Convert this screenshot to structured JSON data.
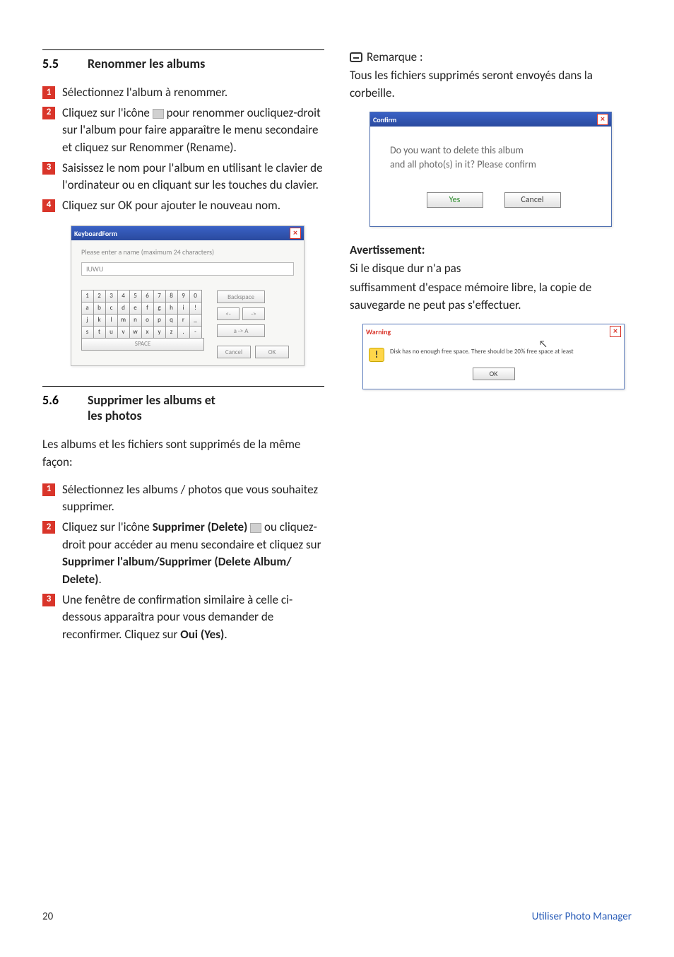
{
  "left": {
    "sec55": {
      "num": "5.5",
      "title": "Renommer les albums",
      "steps": [
        "Sélectionnez l'album à renommer.",
        "Cliquez sur l'icône [icon] pour renommer oucliquez-droit sur l'album pour faire apparaître le menu secondaire et cliquez sur Renommer (Rename).",
        "Saisissez le nom pour l'album en utilisant le clavier de l'ordinateur ou en cliquant sur les touches du clavier.",
        "Cliquez sur OK pour ajouter le nouveau nom."
      ]
    },
    "keyboard": {
      "title": "KeyboardForm",
      "prompt": "Please enter a name (maximum 24 characters)",
      "value": "IUWU",
      "rows": [
        [
          "1",
          "2",
          "3",
          "4",
          "5",
          "6",
          "7",
          "8",
          "9",
          "0"
        ],
        [
          "a",
          "b",
          "c",
          "d",
          "e",
          "f",
          "g",
          "h",
          "i",
          "!"
        ],
        [
          "j",
          "k",
          "l",
          "m",
          "n",
          "o",
          "p",
          "q",
          "r",
          "_"
        ],
        [
          "s",
          "t",
          "u",
          "v",
          "w",
          "x",
          "y",
          "z",
          ".",
          "-"
        ]
      ],
      "space": "SPACE",
      "backspace": "Backspace",
      "left": "<-",
      "right": "->",
      "shift": "a -> A",
      "cancel": "Cancel",
      "ok": "OK"
    },
    "sec56": {
      "num": "5.6",
      "title_l1": "Supprimer les albums et",
      "title_l2": "les photos",
      "intro": "Les albums et les fichiers sont supprimés de la même façon:",
      "step1": "Sélectionnez les albums / photos que vous souhaitez supprimer.",
      "step2_a": "Cliquez sur l'icône ",
      "step2_bold1": "Supprimer (Delete)",
      "step2_b": " ou cliquez-droit pour accéder au menu secondaire et cliquez sur ",
      "step2_bold2": "Supprimer l'album/Supprimer (Delete Album/ Delete)",
      "step2_c": ".",
      "step3_a": "Une fenêtre de confirmation similaire à celle ci-dessous apparaîtra pour vous demander de reconfirmer. Cliquez sur ",
      "step3_bold": "Oui (Yes)",
      "step3_b": "."
    }
  },
  "right": {
    "note_label": "Remarque :",
    "note_body": "Tous les fichiers supprimés seront envoyés dans la corbeille.",
    "confirm": {
      "title": "Confirm",
      "msg_l1": "Do you want to delete this album",
      "msg_l2": "and all photo(s) in it? Please confirm",
      "yes": "Yes",
      "cancel": "Cancel"
    },
    "warn_heading": "Avertissement",
    "warn_heading_colon": ":",
    "warn_body_l1": "Si le disque dur n'a pas",
    "warn_body_l2": "suffisamment d'espace mémoire libre, la copie de sauvegarde ne peut pas s'effectuer.",
    "warning": {
      "title": "Warning",
      "msg": "Disk has no enough free space. There should be 20%  free space at least",
      "ok": "OK"
    }
  },
  "footer": {
    "page": "20",
    "chapter": "Utiliser Photo Manager"
  },
  "badges": {
    "1": "1",
    "2": "2",
    "3": "3",
    "4": "4"
  }
}
